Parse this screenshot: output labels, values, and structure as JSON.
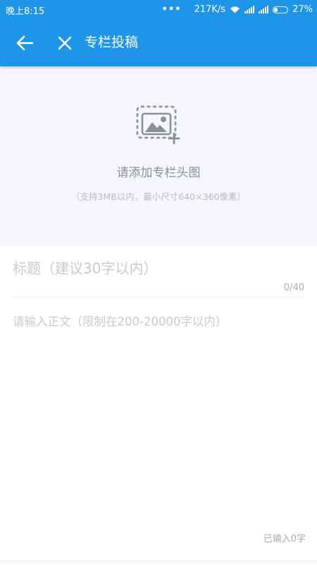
{
  "status_bar": {
    "time": "晚上8:15",
    "dots": "•••",
    "network_speed": "217K/s",
    "battery_percent": "27%",
    "battery_level": 0.27
  },
  "app_bar": {
    "back_icon": "arrow-left-icon",
    "close_icon": "close-icon",
    "title": "专栏投稿"
  },
  "cover": {
    "icon": "add-image-icon",
    "label": "请添加专栏头图",
    "hint": "（支持3MB以内，最小尺寸640×360像素）"
  },
  "title_field": {
    "placeholder": "标题（建议30字以内）",
    "value": "",
    "counter": "0/40"
  },
  "body_field": {
    "placeholder": "请输入正文（限制在200-20000字以内）",
    "value": "",
    "counter": "已输入0字"
  },
  "colors": {
    "primary": "#1e95e8",
    "cover_bg": "#f5f6fa",
    "placeholder": "#c7c9cf"
  }
}
